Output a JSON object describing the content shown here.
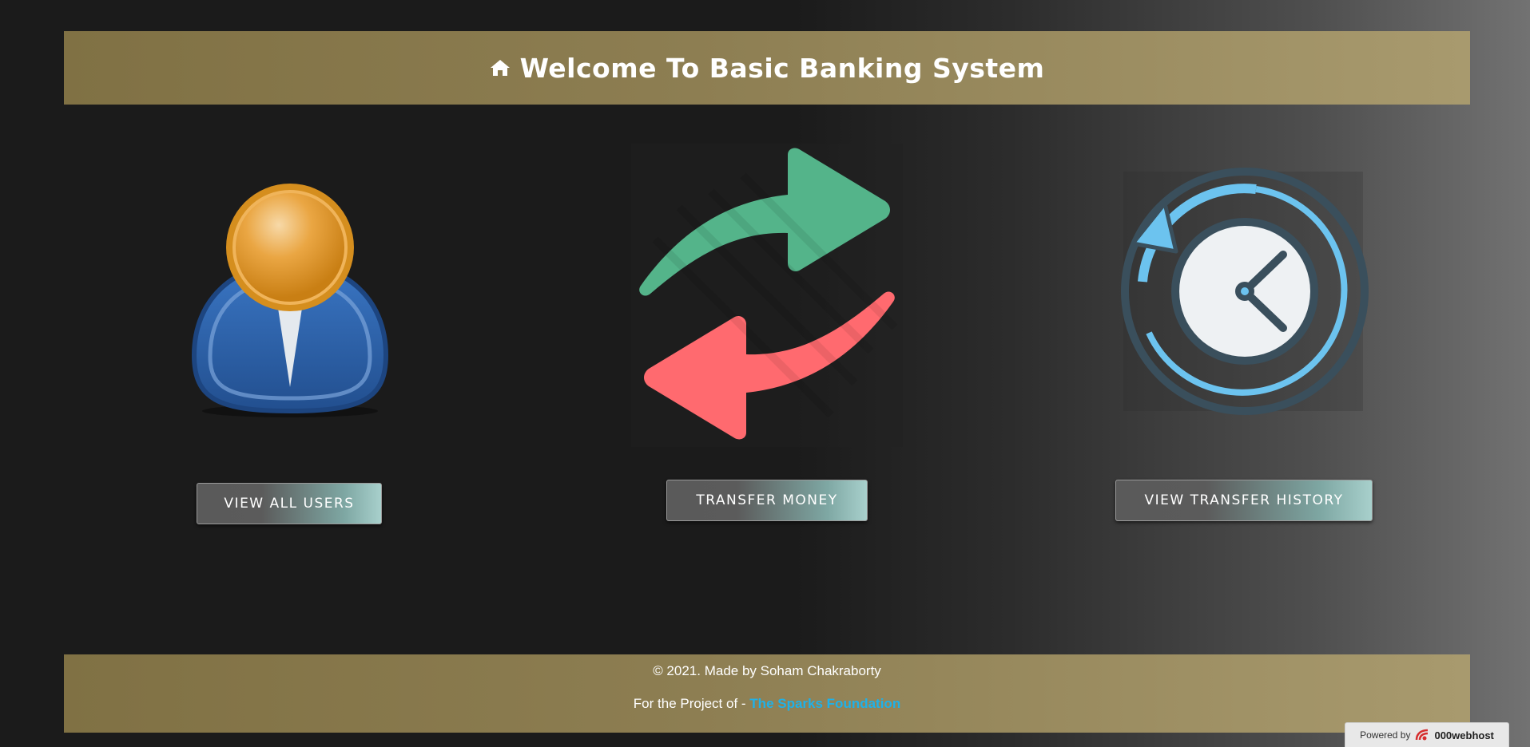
{
  "header": {
    "title": "Welcome To Basic Banking System",
    "icon": "home-icon"
  },
  "cards": [
    {
      "name": "users",
      "button_label": "VIEW ALL USERS",
      "icon": "user-icon"
    },
    {
      "name": "transfer",
      "button_label": "TRANSFER MONEY",
      "icon": "transfer-arrows-icon"
    },
    {
      "name": "history",
      "button_label": "VIEW TRANSFER HISTORY",
      "icon": "history-clock-icon"
    }
  ],
  "footer": {
    "copyright": "© 2021. Made by Soham Chakraborty",
    "project_prefix": "For the Project of - ",
    "project_link": "The Sparks Foundation"
  },
  "badge": {
    "prefix": "Powered by",
    "brand": "000webhost"
  },
  "colors": {
    "banner": "#8d7e52",
    "link": "#1fb1e8",
    "user_head": "#e29a2a",
    "user_body": "#2f62a8",
    "arrow_green": "#52b58a",
    "arrow_red": "#ff6b70",
    "clock_arrow": "#6cc3ef"
  }
}
